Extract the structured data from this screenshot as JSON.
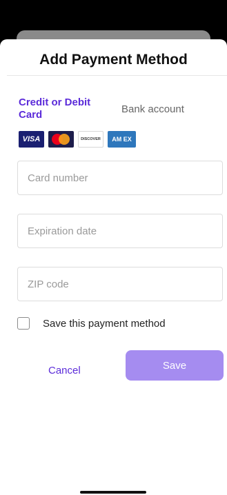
{
  "sheet": {
    "title": "Add Payment Method"
  },
  "tabs": [
    {
      "label": "Credit or Debit Card",
      "active": true
    },
    {
      "label": "Bank account",
      "active": false
    }
  ],
  "card_logos": {
    "visa": "VISA",
    "discover": "DISCOVER",
    "amex": "AM EX"
  },
  "form": {
    "card_number_placeholder": "Card number",
    "expiration_placeholder": "Expiration date",
    "zip_placeholder": "ZIP code",
    "save_method_label": "Save this payment method",
    "save_method_checked": false
  },
  "actions": {
    "cancel": "Cancel",
    "save": "Save"
  },
  "colors": {
    "accent": "#5b2bd9",
    "save_button": "#a58cf0",
    "input_border": "#dcdcdc",
    "backdrop": "#000000"
  }
}
